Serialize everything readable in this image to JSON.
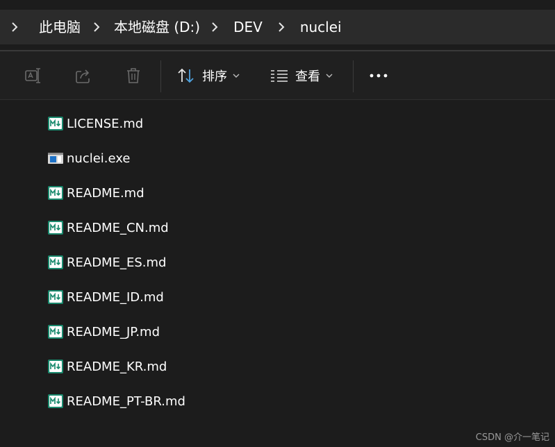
{
  "address_bar": {
    "crumbs": [
      "此电脑",
      "本地磁盘 (D:)",
      "DEV",
      "nuclei"
    ],
    "chevron_icon": "chevron-right-icon"
  },
  "toolbar": {
    "rename_icon": "rename-icon",
    "share_icon": "share-icon",
    "delete_icon": "delete-icon",
    "sort_label": "排序",
    "sort_icon": "sort-arrows-icon",
    "view_label": "查看",
    "view_icon": "view-list-icon",
    "more_icon": "more-horizontal-icon"
  },
  "files": [
    {
      "name": "LICENSE.md",
      "icon": "markdown-file-icon"
    },
    {
      "name": "nuclei.exe",
      "icon": "executable-file-icon"
    },
    {
      "name": "README.md",
      "icon": "markdown-file-icon"
    },
    {
      "name": "README_CN.md",
      "icon": "markdown-file-icon"
    },
    {
      "name": "README_ES.md",
      "icon": "markdown-file-icon"
    },
    {
      "name": "README_ID.md",
      "icon": "markdown-file-icon"
    },
    {
      "name": "README_JP.md",
      "icon": "markdown-file-icon"
    },
    {
      "name": "README_KR.md",
      "icon": "markdown-file-icon"
    },
    {
      "name": "README_PT-BR.md",
      "icon": "markdown-file-icon"
    }
  ],
  "watermark": "CSDN @介一笔记",
  "colors": {
    "background": "#1c1c1c",
    "address_bar": "#2b2b2b",
    "toolbar": "#202020",
    "md_icon_accent": "#1a8a6e",
    "exe_icon_accent": "#1e72c7"
  }
}
